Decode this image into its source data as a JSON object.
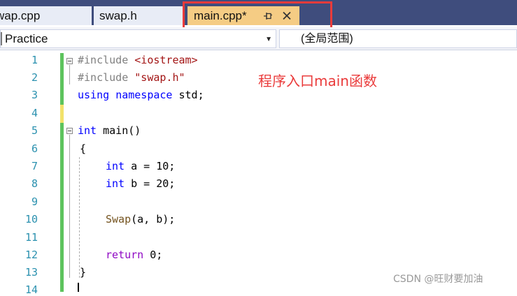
{
  "tabs": [
    {
      "label": "wap.cpp",
      "active": false
    },
    {
      "label": "swap.h",
      "active": false
    },
    {
      "label": "main.cpp*",
      "active": true,
      "pin_icon": "pin-icon",
      "close_icon": "close-icon"
    }
  ],
  "navigation": {
    "project": "Practice",
    "scope": "(全局范围)"
  },
  "annotation": "程序入口main函数",
  "watermark": "CSDN @旺财要加油",
  "colors": {
    "tabbar_bg": "#3f4d7d",
    "active_tab_bg": "#f5cc84",
    "highlight_box": "#ea3b3b",
    "line_numbers": "#2b91af",
    "changed_line_marker": "#5dc35d",
    "unsaved_line_marker": "#f2e26b"
  },
  "line_numbers": [
    "1",
    "2",
    "3",
    "4",
    "5",
    "6",
    "7",
    "8",
    "9",
    "10",
    "11",
    "12",
    "13",
    "14"
  ],
  "code": {
    "l1": {
      "directive": "#include ",
      "header": "<iostream>"
    },
    "l2": {
      "directive": "#include ",
      "header": "\"swap.h\""
    },
    "l3": {
      "kw1": "using",
      "kw2": "namespace",
      "rest": " std;"
    },
    "l5": {
      "type": "int",
      "name": " main()"
    },
    "l6": {
      "text": "{"
    },
    "l7": {
      "type": "int",
      "rest": " a = 10;"
    },
    "l8": {
      "type": "int",
      "rest": " b = 20;"
    },
    "l10": {
      "fn": "Swap",
      "rest": "(a, b);"
    },
    "l12": {
      "kw": "return",
      "rest": " 0;"
    },
    "l13": {
      "text": "}"
    }
  }
}
